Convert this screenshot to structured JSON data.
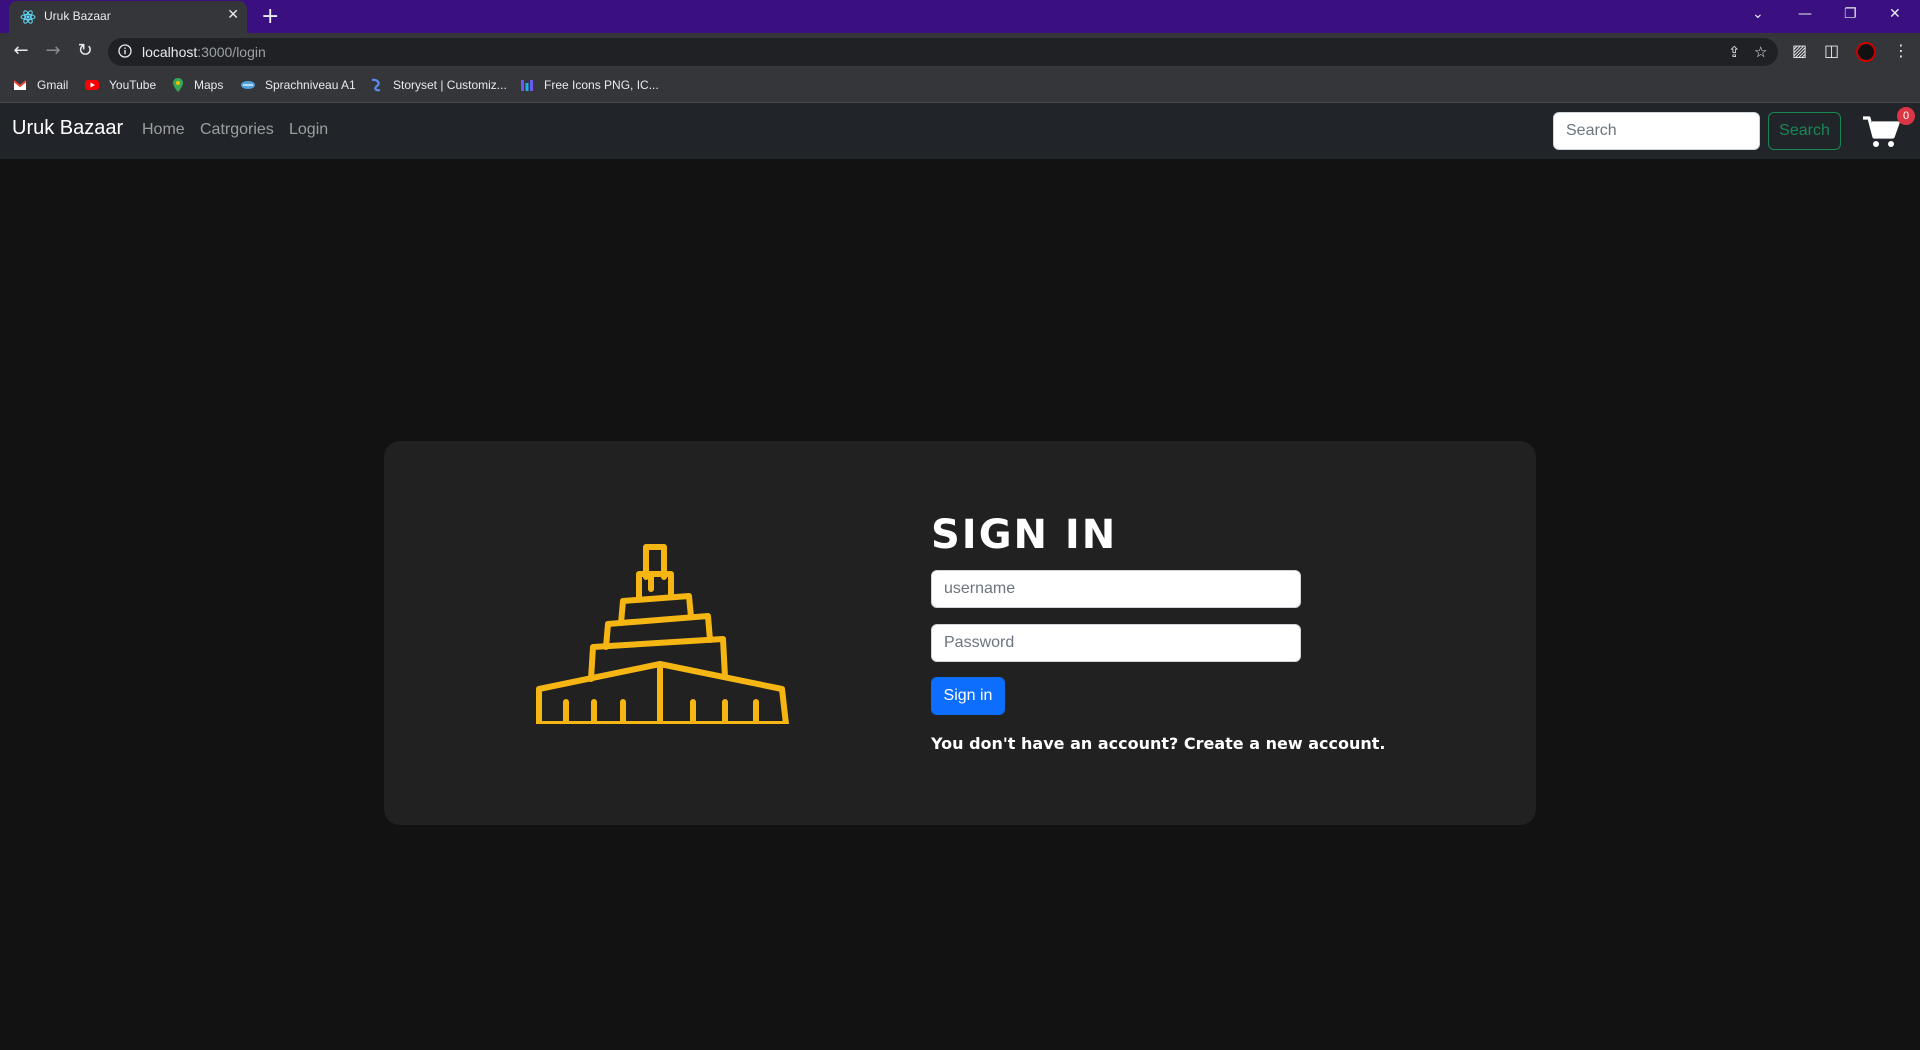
{
  "browser": {
    "tab_title": "Uruk Bazaar",
    "tab_close": "✕",
    "new_tab": "+",
    "url_host": "localhost",
    "url_path": ":3000/login",
    "bookmarks": [
      {
        "label": "Gmail",
        "icon": "gmail-icon"
      },
      {
        "label": "YouTube",
        "icon": "youtube-icon"
      },
      {
        "label": "Maps",
        "icon": "maps-icon"
      },
      {
        "label": "Sprachniveau A1",
        "icon": "bookmark-icon"
      },
      {
        "label": "Storyset | Customiz...",
        "icon": "storyset-icon"
      },
      {
        "label": "Free Icons PNG, IC...",
        "icon": "freeicons-icon"
      }
    ],
    "theme_color": "#3a1080"
  },
  "navbar": {
    "brand": "Uruk Bazaar",
    "links": [
      "Home",
      "Catrgories",
      "Login"
    ],
    "search_placeholder": "Search",
    "search_button": "Search",
    "cart_count": "0"
  },
  "login": {
    "title": "SIGN IN",
    "username_placeholder": "username",
    "password_placeholder": "Password",
    "signin_button": "Sign in",
    "account_prompt": "You don't have an account?",
    "create_link": "Create a new account.",
    "logo_color": "#f5b614",
    "button_color": "#0d6efd"
  }
}
